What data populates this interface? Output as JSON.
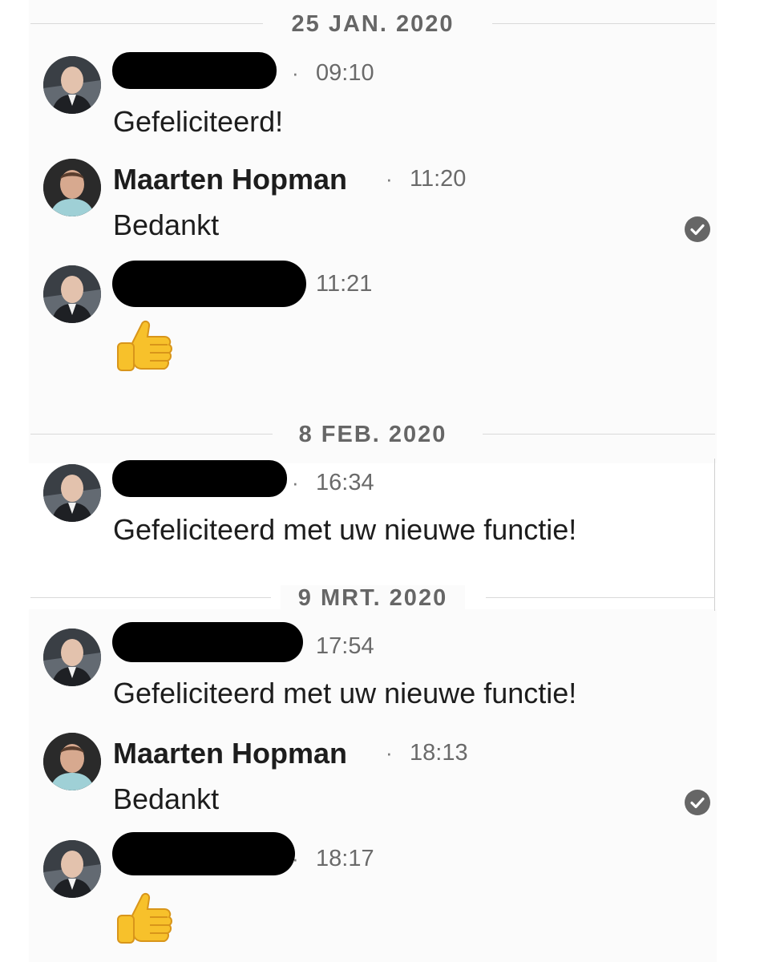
{
  "colors": {
    "background": "#ffffff",
    "panel": "#fbfbfb",
    "text": "#1d1d1d",
    "meta": "#6a6a6a",
    "redaction": "#000000",
    "read_receipt": "#666666"
  },
  "conversation": {
    "groups": [
      {
        "date": "25 JAN. 2020",
        "messages": [
          {
            "sender": "",
            "sender_redacted": true,
            "separator": "·",
            "time": "09:10",
            "text": "Gefeliciteerd!",
            "read": false
          },
          {
            "sender": "Maarten Hopman",
            "sender_redacted": false,
            "separator": "·",
            "time": "11:20",
            "text": "Bedankt",
            "read": true
          },
          {
            "sender": "",
            "sender_redacted": true,
            "separator": "",
            "time": "11:21",
            "text": "",
            "emoji": "thumbs-up-icon",
            "read": false
          }
        ]
      },
      {
        "date": "8 FEB. 2020",
        "messages": [
          {
            "sender": "",
            "sender_redacted": true,
            "separator": "·",
            "time": "16:34",
            "text": "Gefeliciteerd met uw nieuwe functie!",
            "read": false
          }
        ]
      },
      {
        "date": "9 MRT. 2020",
        "messages": [
          {
            "sender": "",
            "sender_redacted": true,
            "separator": "",
            "time": "17:54",
            "text": "Gefeliciteerd met uw nieuwe functie!",
            "read": false
          },
          {
            "sender": "Maarten Hopman",
            "sender_redacted": false,
            "separator": "·",
            "time": "18:13",
            "text": "Bedankt",
            "read": true
          },
          {
            "sender": "",
            "sender_redacted": true,
            "separator": "·",
            "time": "18:17",
            "text": "",
            "emoji": "thumbs-up-icon",
            "read": false
          }
        ]
      }
    ]
  }
}
